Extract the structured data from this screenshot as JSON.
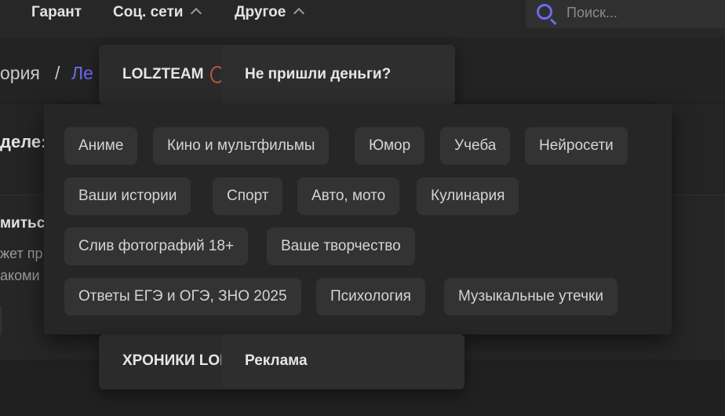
{
  "nav": {
    "items": [
      {
        "label": "Гарант"
      },
      {
        "label": "Соц. сети"
      },
      {
        "label": "Другое"
      }
    ]
  },
  "search": {
    "placeholder": "Поиск..."
  },
  "background": {
    "breadcrumb_part": "ория",
    "breadcrumb_sep": "/",
    "breadcrumb_link": "Ле",
    "section_heading": "деле:",
    "text_1": "миться",
    "text_2": "жет пр",
    "text_3": "акоми"
  },
  "dropdown": {
    "head_left": "LOLZTEAM",
    "head_right": "Не пришли деньги?",
    "tags": [
      "Аниме",
      "Кино и мультфильмы",
      "Юмор",
      "Учеба",
      "Нейросети",
      "Ваши истории",
      "Спорт",
      "Авто, мото",
      "Кулинария",
      "Слив фотографий 18+",
      "Ваше творчество",
      "Ответы ЕГЭ и ОГЭ, ЗНО 2025",
      "Психология",
      "Музыкальные утечки"
    ],
    "foot_left": "ХРОНИКИ LOLZ",
    "foot_right": "Реклама"
  },
  "colors": {
    "accent": "#6a6cf0",
    "badge": "#c0543c"
  }
}
